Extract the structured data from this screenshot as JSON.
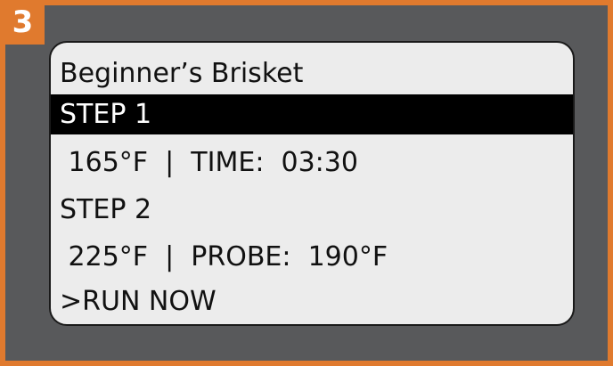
{
  "badge": {
    "number": "3"
  },
  "display": {
    "title": "Beginner’s Brisket",
    "rows": [
      {
        "text": "STEP 1",
        "selected": true
      },
      {
        "text": " 165°F  |  TIME:  03:30",
        "selected": false
      },
      {
        "text": "STEP 2",
        "selected": false
      },
      {
        "text": " 225°F  |  PROBE:  190°F",
        "selected": false
      },
      {
        "text": ">RUN NOW",
        "selected": false
      }
    ]
  },
  "colors": {
    "accent": "#e07a2e",
    "panel": "#58595b",
    "screen": "#ececec",
    "highlight": "#000000"
  }
}
